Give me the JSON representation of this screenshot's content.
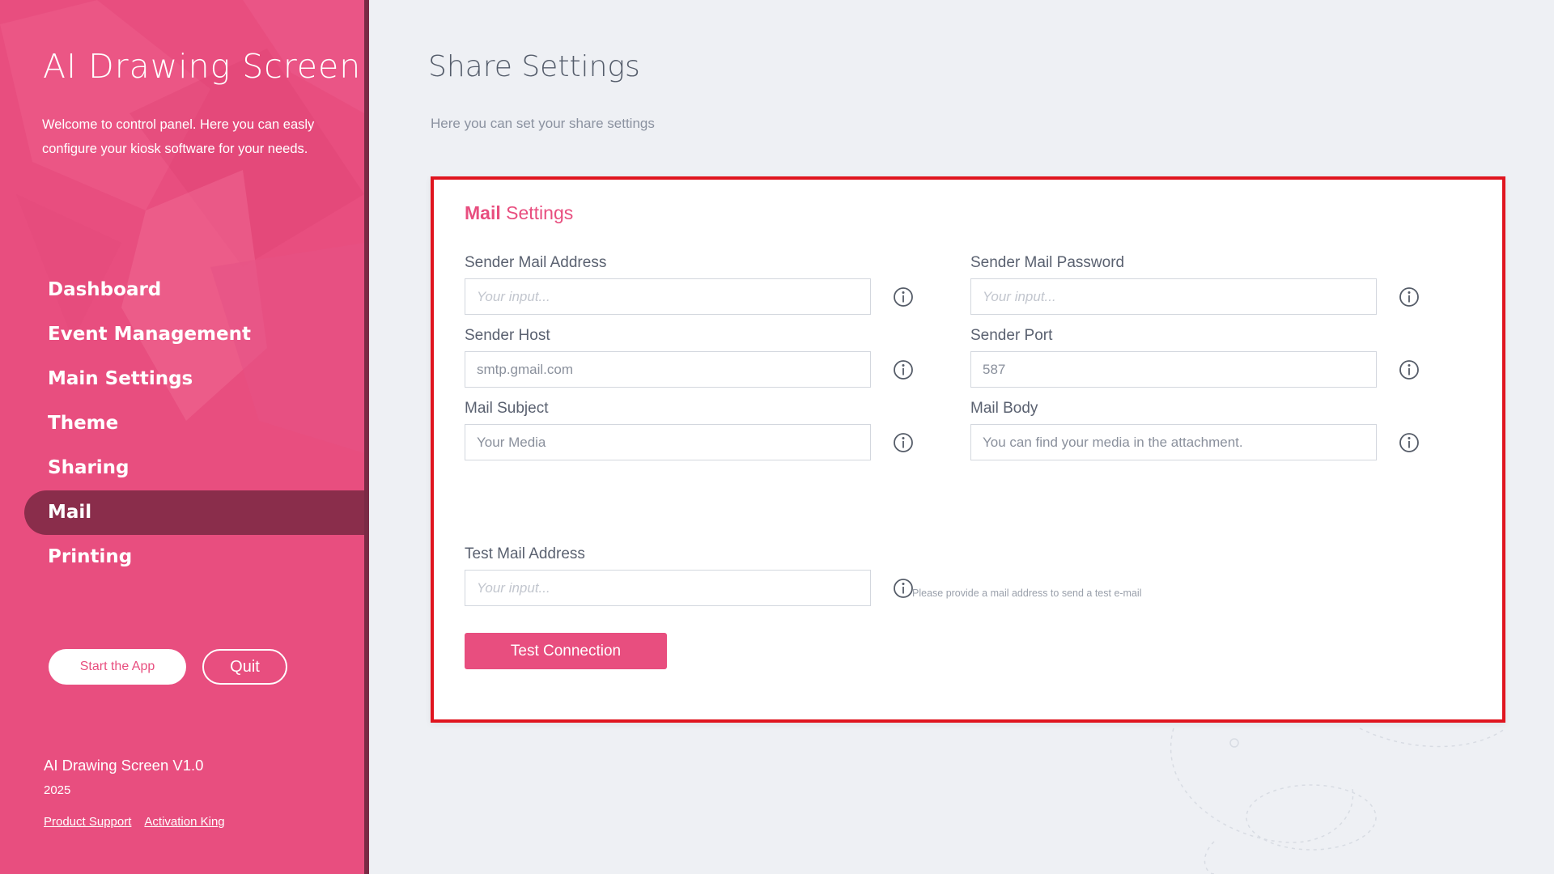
{
  "sidebar": {
    "app_title": "AI Drawing Screen",
    "welcome": "Welcome to control panel. Here you can easly configure your kiosk software for your needs.",
    "nav": [
      {
        "label": "Dashboard"
      },
      {
        "label": "Event Management"
      },
      {
        "label": "Main Settings"
      },
      {
        "label": "Theme"
      },
      {
        "label": "Sharing"
      },
      {
        "label": "Mail",
        "active": true
      },
      {
        "label": "Printing"
      }
    ],
    "start_button": "Start the App",
    "quit_button": "Quit",
    "version": "AI Drawing Screen V1.0",
    "year": "2025",
    "links": [
      "Product Support",
      "Activation King"
    ],
    "color": "#e84e7f",
    "active_color": "#8a2d4b"
  },
  "main": {
    "title": "Share Settings",
    "subtitle": "Here you can set your share settings"
  },
  "mail_settings": {
    "title_strong": "Mail",
    "title_rest": " Settings",
    "fields": {
      "sender_mail_address": {
        "label": "Sender Mail Address",
        "value": "",
        "placeholder": "Your input..."
      },
      "sender_mail_password": {
        "label": "Sender Mail Password",
        "value": "",
        "placeholder": "Your input..."
      },
      "sender_host": {
        "label": "Sender Host",
        "value": "smtp.gmail.com",
        "placeholder": ""
      },
      "sender_port": {
        "label": "Sender Port",
        "value": "587",
        "placeholder": ""
      },
      "mail_subject": {
        "label": "Mail Subject",
        "value": "Your Media",
        "placeholder": ""
      },
      "mail_body": {
        "label": "Mail Body",
        "value": "You can find your media in the attachment.",
        "placeholder": ""
      },
      "test_mail_address": {
        "label": "Test Mail Address",
        "value": "",
        "placeholder": "Your input..."
      }
    },
    "test_hint": "Please provide a mail address to send a test e-mail",
    "test_button": "Test Connection",
    "highlight_color": "#e0151f",
    "icons": [
      "info-icon"
    ]
  }
}
